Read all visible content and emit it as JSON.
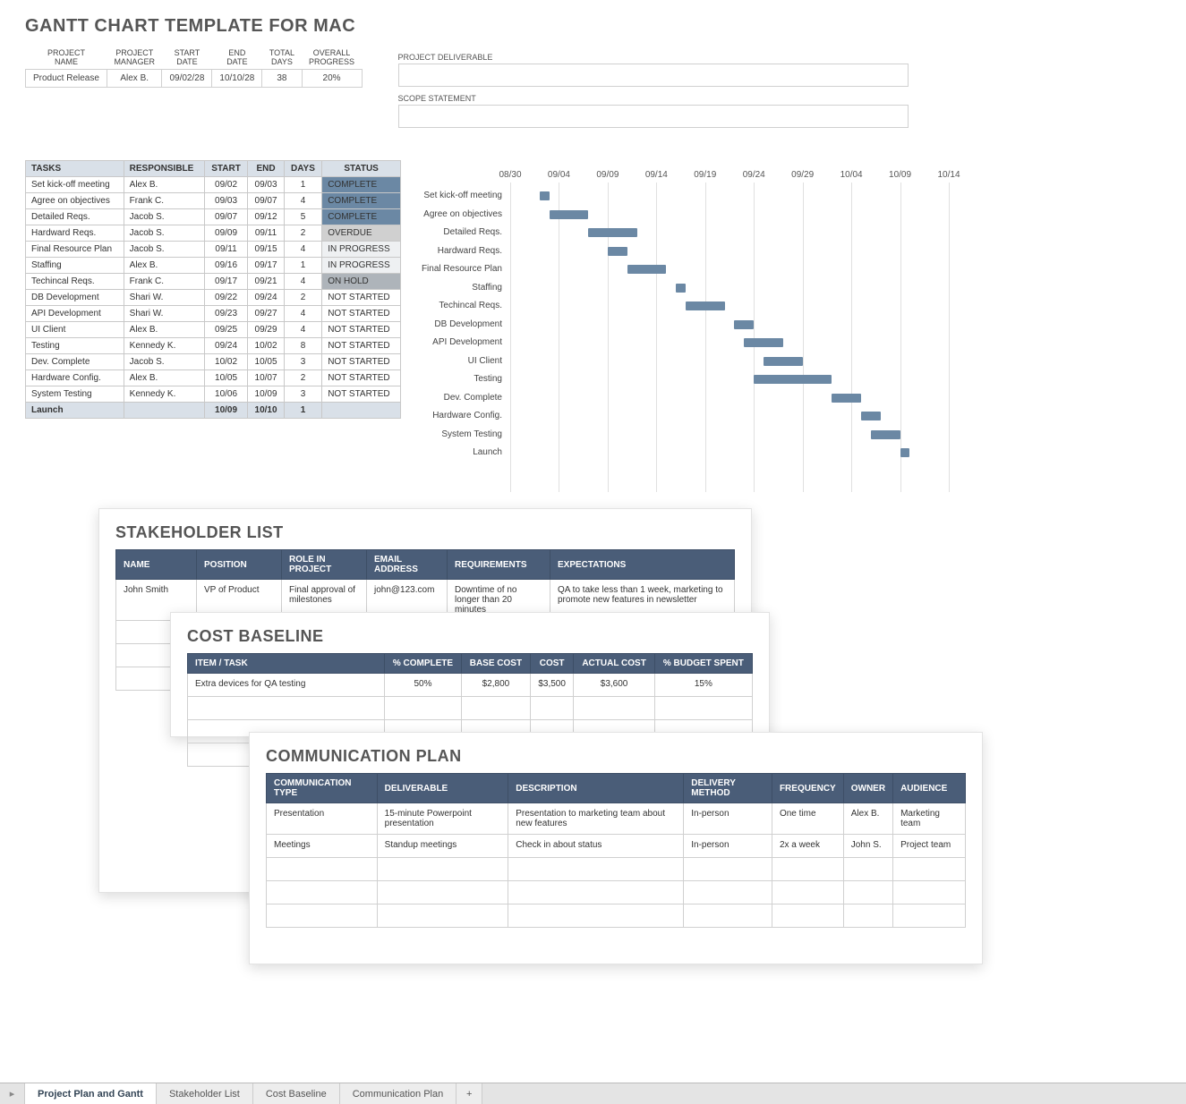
{
  "title": "GANTT CHART TEMPLATE FOR MAC",
  "summary": {
    "headers": [
      "PROJECT\nNAME",
      "PROJECT\nMANAGER",
      "START\nDATE",
      "END\nDATE",
      "TOTAL\nDAYS",
      "OVERALL\nPROGRESS"
    ],
    "values": [
      "Product Release",
      "Alex B.",
      "09/02/28",
      "10/10/28",
      "38",
      "20%"
    ]
  },
  "deliverable_label": "PROJECT DELIVERABLE",
  "scope_label": "SCOPE STATEMENT",
  "task_headers": [
    "TASKS",
    "RESPONSIBLE",
    "START",
    "END",
    "DAYS",
    "STATUS"
  ],
  "tasks": [
    {
      "name": "Set kick-off meeting",
      "resp": "Alex B.",
      "start": "09/02",
      "end": "09/03",
      "days": "1",
      "status": "COMPLETE",
      "status_cls": "status-complete"
    },
    {
      "name": "Agree on objectives",
      "resp": "Frank C.",
      "start": "09/03",
      "end": "09/07",
      "days": "4",
      "status": "COMPLETE",
      "status_cls": "status-complete"
    },
    {
      "name": "Detailed Reqs.",
      "resp": "Jacob S.",
      "start": "09/07",
      "end": "09/12",
      "days": "5",
      "status": "COMPLETE",
      "status_cls": "status-complete"
    },
    {
      "name": "Hardward Reqs.",
      "resp": "Jacob S.",
      "start": "09/09",
      "end": "09/11",
      "days": "2",
      "status": "OVERDUE",
      "status_cls": "status-overdue"
    },
    {
      "name": "Final Resource Plan",
      "resp": "Jacob S.",
      "start": "09/11",
      "end": "09/15",
      "days": "4",
      "status": "IN PROGRESS",
      "status_cls": "status-inprogress"
    },
    {
      "name": "Staffing",
      "resp": "Alex B.",
      "start": "09/16",
      "end": "09/17",
      "days": "1",
      "status": "IN PROGRESS",
      "status_cls": "status-inprogress"
    },
    {
      "name": "Techincal Reqs.",
      "resp": "Frank C.",
      "start": "09/17",
      "end": "09/21",
      "days": "4",
      "status": "ON HOLD",
      "status_cls": "status-onhold"
    },
    {
      "name": "DB Development",
      "resp": "Shari W.",
      "start": "09/22",
      "end": "09/24",
      "days": "2",
      "status": "NOT STARTED",
      "status_cls": "status-notstarted"
    },
    {
      "name": "API Development",
      "resp": "Shari W.",
      "start": "09/23",
      "end": "09/27",
      "days": "4",
      "status": "NOT STARTED",
      "status_cls": "status-notstarted"
    },
    {
      "name": "UI Client",
      "resp": "Alex B.",
      "start": "09/25",
      "end": "09/29",
      "days": "4",
      "status": "NOT STARTED",
      "status_cls": "status-notstarted"
    },
    {
      "name": "Testing",
      "resp": "Kennedy K.",
      "start": "09/24",
      "end": "10/02",
      "days": "8",
      "status": "NOT STARTED",
      "status_cls": "status-notstarted"
    },
    {
      "name": "Dev. Complete",
      "resp": "Jacob S.",
      "start": "10/02",
      "end": "10/05",
      "days": "3",
      "status": "NOT STARTED",
      "status_cls": "status-notstarted"
    },
    {
      "name": "Hardware Config.",
      "resp": "Alex B.",
      "start": "10/05",
      "end": "10/07",
      "days": "2",
      "status": "NOT STARTED",
      "status_cls": "status-notstarted"
    },
    {
      "name": "System Testing",
      "resp": "Kennedy K.",
      "start": "10/06",
      "end": "10/09",
      "days": "3",
      "status": "NOT STARTED",
      "status_cls": "status-notstarted"
    },
    {
      "name": "Launch",
      "resp": "",
      "start": "10/09",
      "end": "10/10",
      "days": "1",
      "status": "",
      "status_cls": "",
      "launch": true
    }
  ],
  "chart_data": {
    "type": "gantt",
    "x_ticks": [
      "08/30",
      "09/04",
      "09/09",
      "09/14",
      "09/19",
      "09/24",
      "09/29",
      "10/04",
      "10/09",
      "10/14"
    ],
    "x_origin_date": "08/30",
    "x_days_span": 45,
    "bars": [
      {
        "label": "Set kick-off meeting",
        "start_day": 3,
        "duration": 1
      },
      {
        "label": "Agree on objectives",
        "start_day": 4,
        "duration": 4
      },
      {
        "label": "Detailed Reqs.",
        "start_day": 8,
        "duration": 5
      },
      {
        "label": "Hardward Reqs.",
        "start_day": 10,
        "duration": 2
      },
      {
        "label": "Final Resource Plan",
        "start_day": 12,
        "duration": 4
      },
      {
        "label": "Staffing",
        "start_day": 17,
        "duration": 1
      },
      {
        "label": "Techincal Reqs.",
        "start_day": 18,
        "duration": 4
      },
      {
        "label": "DB Development",
        "start_day": 23,
        "duration": 2
      },
      {
        "label": "API Development",
        "start_day": 24,
        "duration": 4
      },
      {
        "label": "UI Client",
        "start_day": 26,
        "duration": 4
      },
      {
        "label": "Testing",
        "start_day": 25,
        "duration": 8
      },
      {
        "label": "Dev. Complete",
        "start_day": 33,
        "duration": 3
      },
      {
        "label": "Hardware Config.",
        "start_day": 36,
        "duration": 2
      },
      {
        "label": "System Testing",
        "start_day": 37,
        "duration": 3
      },
      {
        "label": "Launch",
        "start_day": 40,
        "duration": 1
      }
    ]
  },
  "stakeholder": {
    "title": "STAKEHOLDER LIST",
    "headers": [
      "NAME",
      "POSITION",
      "ROLE IN PROJECT",
      "EMAIL ADDRESS",
      "REQUIREMENTS",
      "EXPECTATIONS"
    ],
    "rows": [
      [
        "John Smith",
        "VP of Product",
        "Final approval of milestones",
        "john@123.com",
        "Downtime of no longer than 20 minutes",
        "QA to take less than 1 week, marketing to promote new features in newsletter"
      ]
    ]
  },
  "cost": {
    "title": "COST BASELINE",
    "headers": [
      "ITEM / TASK",
      "% COMPLETE",
      "BASE COST",
      "COST",
      "ACTUAL COST",
      "% BUDGET SPENT"
    ],
    "rows": [
      [
        "Extra devices for QA testing",
        "50%",
        "$2,800",
        "$3,500",
        "$3,600",
        "15%"
      ]
    ]
  },
  "comm": {
    "title": "COMMUNICATION PLAN",
    "headers": [
      "COMMUNICATION TYPE",
      "DELIVERABLE",
      "DESCRIPTION",
      "DELIVERY METHOD",
      "FREQUENCY",
      "OWNER",
      "AUDIENCE"
    ],
    "rows": [
      [
        "Presentation",
        "15-minute Powerpoint presentation",
        "Presentation to marketing team about new features",
        "In-person",
        "One time",
        "Alex B.",
        "Marketing team"
      ],
      [
        "Meetings",
        "Standup meetings",
        "Check in about status",
        "In-person",
        "2x a week",
        "John S.",
        "Project team"
      ]
    ]
  },
  "tabs": {
    "items": [
      "Project Plan and Gantt",
      "Stakeholder List",
      "Cost Baseline",
      "Communication Plan"
    ],
    "active_index": 0,
    "add": "+"
  }
}
